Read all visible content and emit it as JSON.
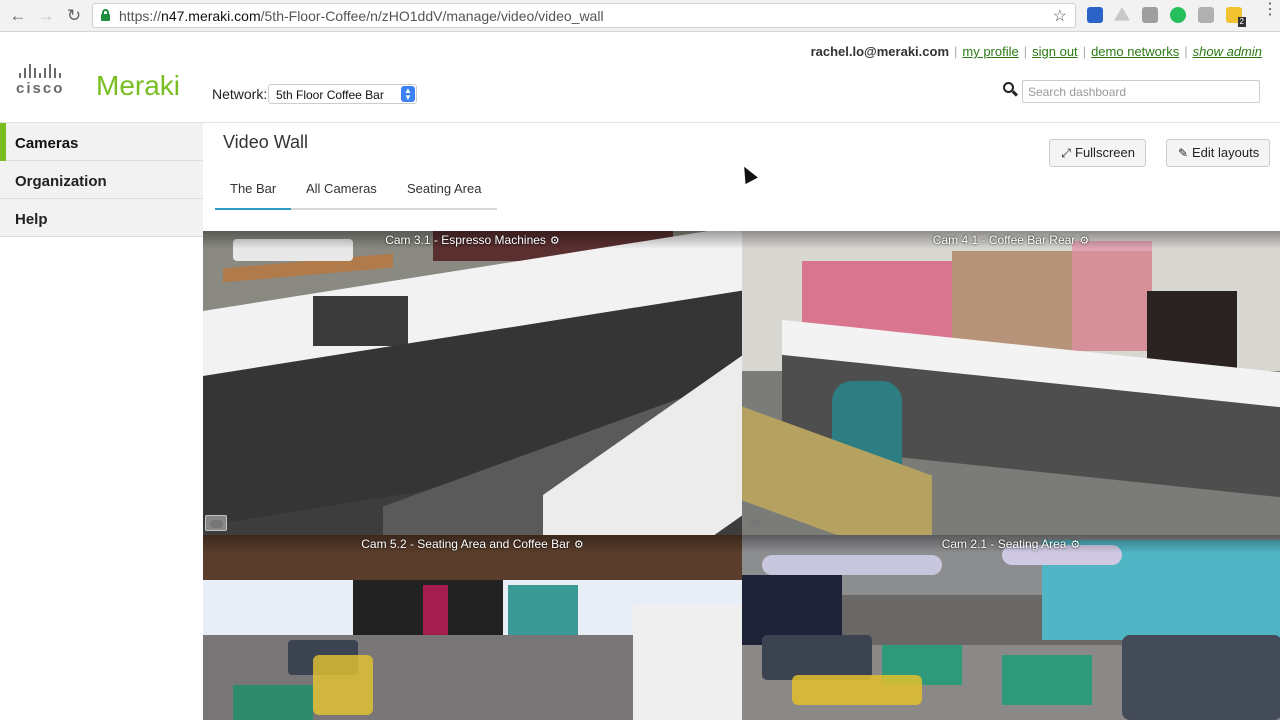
{
  "browser": {
    "url_scheme": "https://",
    "url_host": "n47.meraki.com",
    "url_path": "/5th-Floor-Coffee/n/zHO1ddV/manage/video/video_wall",
    "extensions": [
      {
        "name": "calendar-extension",
        "color": "#2b63c9"
      },
      {
        "name": "drive-extension",
        "color": "#bdbdbd"
      },
      {
        "name": "shield-extension",
        "color": "#9e9e9e"
      },
      {
        "name": "phone-extension",
        "color": "#25c05c"
      },
      {
        "name": "script-extension",
        "color": "#b0b0b0"
      },
      {
        "name": "notes-extension",
        "color": "#f2c230",
        "badge": "2"
      }
    ]
  },
  "header": {
    "brand_cisco": "cisco",
    "brand_meraki": "Meraki",
    "network_label": "Network:",
    "network_selected": "5th Floor Coffee Bar",
    "user_email": "rachel.lo@meraki.com",
    "links": {
      "my_profile": "my profile",
      "sign_out": "sign out",
      "demo_networks": "demo networks",
      "show_admin": "show admin"
    },
    "search_placeholder": "Search dashboard"
  },
  "sidebar": {
    "items": [
      {
        "label": "Cameras",
        "active": true
      },
      {
        "label": "Organization",
        "active": false
      },
      {
        "label": "Help",
        "active": false
      }
    ]
  },
  "main": {
    "title": "Video Wall",
    "buttons": {
      "fullscreen": "Fullscreen",
      "edit_layouts": "Edit layouts"
    },
    "tabs": [
      {
        "label": "The Bar",
        "active": true
      },
      {
        "label": "All Cameras",
        "active": false
      },
      {
        "label": "Seating Area",
        "active": false
      }
    ],
    "cameras": [
      {
        "label": "Cam 3.1 - Espresso Machines"
      },
      {
        "label": "Cam 4.1 - Coffee Bar Rear"
      },
      {
        "label": "Cam 5.2 - Seating Area and Coffee Bar"
      },
      {
        "label": "Cam 2.1 - Seating Area"
      }
    ]
  },
  "colors": {
    "brand_green": "#78be20",
    "link_green": "#2a7a12",
    "tab_accent": "#2f9ac8"
  }
}
